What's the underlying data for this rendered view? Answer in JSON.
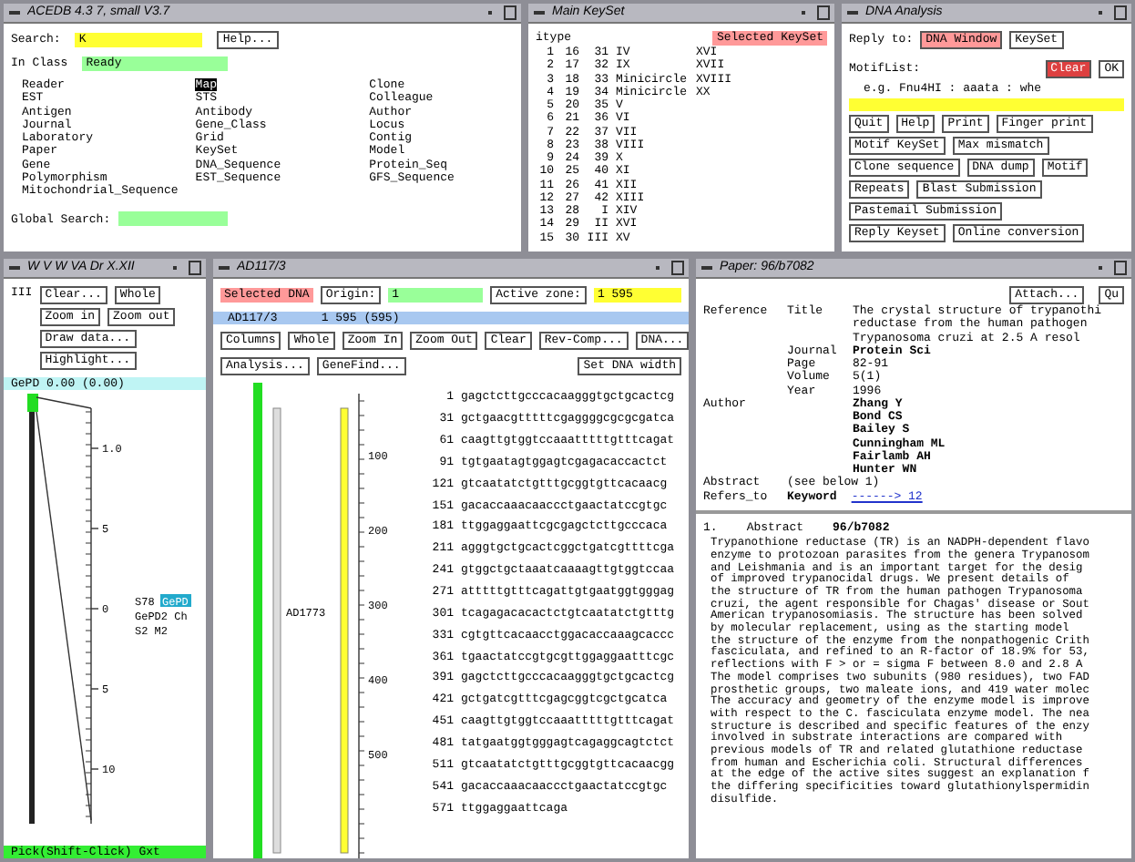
{
  "acedb_window": {
    "title": "ACEDB 4.3 7, small V3.7",
    "search_label": "Search:",
    "search_value": "K",
    "help_button": "Help...",
    "class_label": "In Class",
    "class_value": "Ready",
    "class_columns": [
      [
        {
          "label": "Reader",
          "selected": false
        },
        {
          "label": "EST",
          "selected": false
        },
        {
          "label": "Antigen",
          "selected": false
        },
        {
          "label": "Journal",
          "selected": false
        },
        {
          "label": "Laboratory",
          "selected": false
        },
        {
          "label": "Paper",
          "selected": false
        },
        {
          "label": "Gene",
          "selected": false
        },
        {
          "label": "Polymorphism",
          "selected": false
        },
        {
          "label": "Mitochondrial_Sequence",
          "selected": false
        }
      ],
      [
        {
          "label": "Map",
          "selected": true
        },
        {
          "label": "STS",
          "selected": false
        },
        {
          "label": "Antibody",
          "selected": false
        },
        {
          "label": "Gene_Class",
          "selected": false
        },
        {
          "label": "Grid",
          "selected": false
        },
        {
          "label": "KeySet",
          "selected": false
        },
        {
          "label": "DNA_Sequence",
          "selected": false
        },
        {
          "label": "EST_Sequence",
          "selected": false
        }
      ],
      [
        {
          "label": "Clone",
          "selected": false
        },
        {
          "label": "Colleague",
          "selected": false
        },
        {
          "label": "Author",
          "selected": false
        },
        {
          "label": "Locus",
          "selected": false
        },
        {
          "label": "Contig",
          "selected": false
        },
        {
          "label": "Model",
          "selected": false
        },
        {
          "label": "Protein_Seq",
          "selected": false
        },
        {
          "label": "GFS_Sequence",
          "selected": false
        }
      ]
    ],
    "global_search_label": "Global Search:"
  },
  "keyset_window": {
    "title": "Main KeySet",
    "header": "itype",
    "selected_label": "Selected KeySet",
    "rows": [
      [
        "1",
        "16",
        "31",
        "IV",
        "XVI"
      ],
      [
        "2",
        "17",
        "32",
        "IX",
        "XVII"
      ],
      [
        "3",
        "18",
        "33",
        "Minicircle",
        "XVIII"
      ],
      [
        "4",
        "19",
        "34",
        "Minicircle",
        "XX"
      ],
      [
        "5",
        "20",
        "35",
        "V"
      ],
      [
        "6",
        "21",
        "36",
        "VI"
      ],
      [
        "7",
        "22",
        "37",
        "VII"
      ],
      [
        "8",
        "23",
        "38",
        "VIII"
      ],
      [
        "9",
        "24",
        "39",
        "X"
      ],
      [
        "10",
        "25",
        "40",
        "XI"
      ],
      [
        "11",
        "26",
        "41",
        "XII"
      ],
      [
        "12",
        "27",
        "42",
        "XIII"
      ],
      [
        "13",
        "28",
        "I",
        "XIV"
      ],
      [
        "14",
        "29",
        "II",
        "XVI"
      ],
      [
        "15",
        "30",
        "III",
        "XV"
      ]
    ]
  },
  "dna_window": {
    "title": "DNA Analysis",
    "reply_label": "Reply to:",
    "reply_options": [
      {
        "label": "DNA Window",
        "selected": true
      },
      {
        "label": "KeySet",
        "selected": false
      }
    ],
    "motif_label": "MotifList:",
    "clear_button": "Clear",
    "ok_button": "OK",
    "hint": "e.g. Fnu4HI : aaata : whe",
    "button_rows": [
      [
        "Quit",
        "Help",
        "Print",
        "Finger print"
      ],
      [
        "Motif KeySet",
        "Max mismatch"
      ],
      [
        "Clone sequence",
        "DNA dump",
        "Motif"
      ],
      [
        "Repeats",
        "Blast Submission"
      ],
      [
        "Pastemail Submission"
      ],
      [
        "Reply Keyset",
        "Online conversion"
      ]
    ]
  },
  "map_window": {
    "title": "W V W VA Dr X.XII",
    "label": "III",
    "button_rows": [
      [
        "Clear...",
        "Whole"
      ],
      [
        "Zoom in",
        "Zoom out"
      ],
      [
        "Draw data..."
      ],
      [
        "Highlight..."
      ]
    ],
    "status": "GePD 0.00 (0.00)",
    "ticks": [
      "1.0",
      "5",
      "0",
      "5",
      "10"
    ],
    "markers": [
      {
        "label": "S78",
        "tag": "GePD"
      },
      {
        "label": "GePD2 Ch"
      },
      {
        "label": "S2 M2"
      }
    ],
    "footer": "Pick(Shift-Click)  Gxt"
  },
  "sequence_window": {
    "title": "AD117/3",
    "selected_label": "Selected DNA",
    "origin_button": "Origin:",
    "origin_value": "1",
    "zone_button": "Active zone:",
    "zone_value": "1 595",
    "info_name": "AD117/3",
    "info_range": "1 595 (595)",
    "button_rows": [
      [
        "Columns",
        "Whole",
        "Zoom In",
        "Zoom Out",
        "Clear",
        "Rev-Comp...",
        "DNA..."
      ],
      [
        "Analysis...",
        "GeneFind...",
        "Set DNA width"
      ]
    ],
    "clone_label": "AD1773",
    "ruler": [
      "100",
      "200",
      "300",
      "400",
      "500"
    ],
    "lines": [
      [
        "1",
        "gagctcttgcccacaagggtgctgcactcg"
      ],
      [
        "31",
        "gctgaacgtttttcgaggggcgcgcgatca"
      ],
      [
        "61",
        "caagttgtggtccaaatttttgtttcagat"
      ],
      [
        "91",
        "tgtgaatagtggagtcgagacaccactct"
      ],
      [
        "121",
        "gtcaatatctgtttgcggtgttcacaacg"
      ],
      [
        "151",
        "gacaccaaacaaccctgaactatccgtgc"
      ],
      [
        "181",
        "ttggaggaattcgcgagctcttgcccaca"
      ],
      [
        "211",
        "agggtgctgcactcggctgatcgttttcga"
      ],
      [
        "241",
        "gtggctgctaaatcaaaagttgtggtccaa"
      ],
      [
        "271",
        "atttttgtttcagattgtgaatggtgggag"
      ],
      [
        "301",
        "tcagagacacactctgtcaatatctgtttg"
      ],
      [
        "331",
        "cgtgttcacaacctggacaccaaagcaccc"
      ],
      [
        "361",
        "tgaactatccgtgcgttggaggaatttcgc"
      ],
      [
        "391",
        "gagctcttgcccacaagggtgctgcactcg"
      ],
      [
        "421",
        "gctgatcgtttcgagcggtcgctgcatca"
      ],
      [
        "451",
        "caagttgtggtccaaatttttgtttcagat"
      ],
      [
        "481",
        "tatgaatggtgggagtcagaggcagtctct"
      ],
      [
        "511",
        "gtcaatatctgtttgcggtgttcacaacgg"
      ],
      [
        "541",
        "gacaccaaacaaccctgaactatccgtgc"
      ],
      [
        "571",
        "ttggaggaattcaga"
      ]
    ]
  },
  "paper_window": {
    "title": "Paper: 96/b7082",
    "attach_button": "Attach...",
    "quit_button": "Qu",
    "reference_label": "Reference",
    "fields": [
      {
        "label": "Title",
        "lines": [
          "The crystal structure of trypanothi",
          "reductase from the human pathogen",
          "Trypanosoma cruzi at 2.5 A resol"
        ]
      },
      {
        "label": "Journal",
        "lines": [
          "Protein Sci"
        ]
      },
      {
        "label": "Page",
        "lines": [
          "82-91"
        ]
      },
      {
        "label": "Volume",
        "lines": [
          "5(1)"
        ]
      },
      {
        "label": "Year",
        "lines": [
          "1996"
        ]
      }
    ],
    "author_label": "Author",
    "authors": [
      "Zhang Y",
      "Bond CS",
      "Bailey S",
      "Cunningham ML",
      "Fairlamb AH",
      "Hunter WN"
    ],
    "abstract_label": "Abstract",
    "abstract_ref": "(see below 1)",
    "refers_label": "Refers_to",
    "refers_key": "Keyword",
    "refers_link": "------> 12",
    "abstract_number": "1.",
    "abstract_heading": "Abstract",
    "abstract_id": "96/b7082",
    "abstract_lines": [
      "Trypanothione reductase (TR) is an NADPH-dependent flavo",
      "enzyme to protozoan parasites from the genera Trypanosom",
      "and Leishmania and is an important target for the desig",
      "of improved trypanocidal drugs. We present details of",
      "the structure of TR from the human pathogen Trypanosoma",
      "cruzi, the agent responsible for Chagas' disease or Sout",
      "American trypanosomiasis. The structure has been solved",
      "by molecular replacement, using as the starting model",
      "the structure of the enzyme from the nonpathogenic Crith",
      "fasciculata, and refined to an R-factor of 18.9% for 53,",
      "reflections with F > or = sigma F between 8.0 and 2.8 A",
      "The model comprises two subunits (980 residues), two FAD",
      "prosthetic groups, two maleate ions, and 419 water molec",
      "The accuracy and geometry of the enzyme model is improve",
      "with respect to the C. fasciculata enzyme model. The nea",
      "structure is described and specific features of the enzy",
      "involved in substrate interactions are compared with",
      "previous models of TR and related glutathione reductase",
      "from human and Escherichia coli. Structural differences",
      "at the edge of the active sites suggest an explanation f",
      "the differing specificities toward glutathionylspermidin",
      "disulfide."
    ]
  }
}
